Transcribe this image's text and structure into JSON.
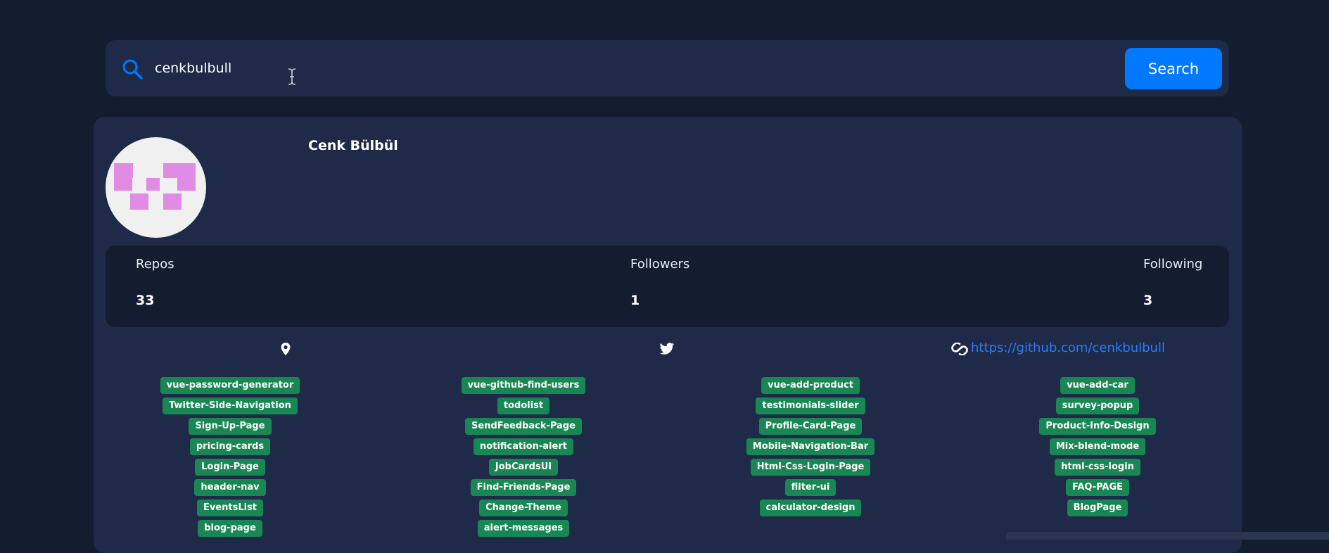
{
  "search": {
    "value": "cenkbulbull",
    "button_label": "Search"
  },
  "profile": {
    "name": "Cenk Bülbül",
    "stats": [
      {
        "label": "Repos",
        "value": "33"
      },
      {
        "label": "Followers",
        "value": "1"
      },
      {
        "label": "Following",
        "value": "3"
      }
    ],
    "blog_url": "https://github.com/cenkbulbull"
  },
  "repos": {
    "columns": [
      [
        "vue-password-generator",
        "Twitter-Side-Navigation",
        "Sign-Up-Page",
        "pricing-cards",
        "Login-Page",
        "header-nav",
        "EventsList",
        "blog-page"
      ],
      [
        "vue-github-find-users",
        "todolist",
        "SendFeedback-Page",
        "notification-alert",
        "JobCardsUI",
        "Find-Friends-Page",
        "Change-Theme",
        "alert-messages"
      ],
      [
        "vue-add-product",
        "testimonials-slider",
        "Profile-Card-Page",
        "Mobile-Navigation-Bar",
        "Html-Css-Login-Page",
        "filter-ui",
        "calculator-design"
      ],
      [
        "vue-add-car",
        "survey-popup",
        "Product-Info-Design",
        "Mix-blend-mode",
        "html-css-login",
        "FAQ-PAGE",
        "BlogPage"
      ]
    ]
  },
  "icons": {
    "search": "search-icon",
    "location": "location-pin-icon",
    "twitter": "twitter-icon",
    "link": "link-icon",
    "cursor": "text-cursor-icon"
  },
  "colors": {
    "background": "#141d2f",
    "card": "#1e2a47",
    "accent": "#0079ff",
    "tag": "#198754",
    "link": "#2b7cff",
    "avatar_identicon": "#e08be4"
  }
}
